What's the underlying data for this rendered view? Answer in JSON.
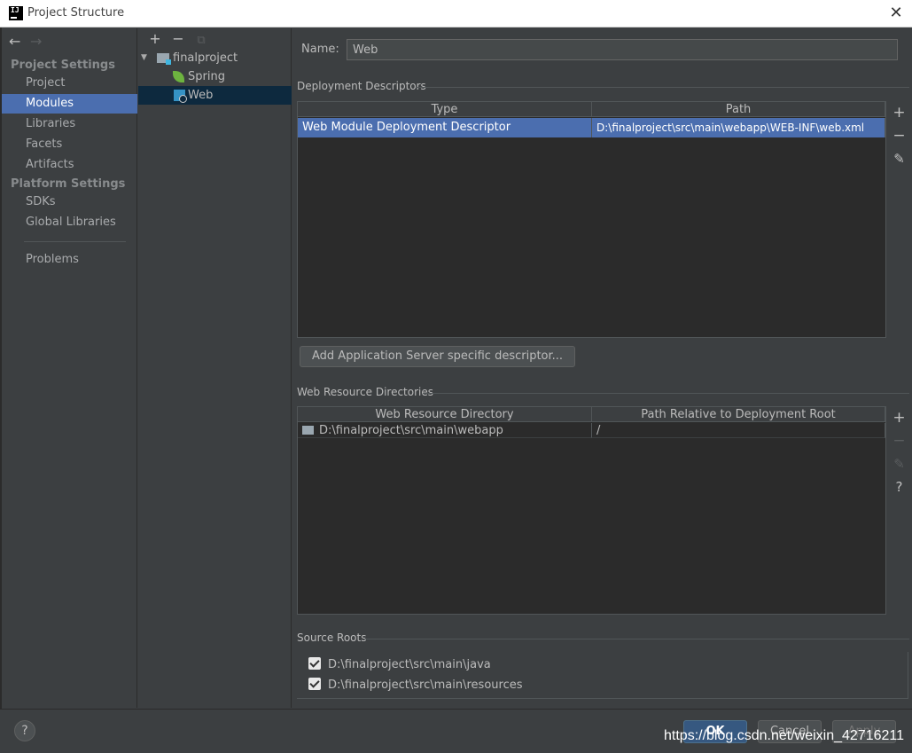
{
  "window": {
    "title": "Project Structure",
    "close_glyph": "✕",
    "logo_text": "IJ"
  },
  "left_nav": {
    "back_glyph": "←",
    "forward_glyph": "→",
    "project_settings_title": "Project Settings",
    "project_settings_items": [
      {
        "label": "Project",
        "selected": false
      },
      {
        "label": "Modules",
        "selected": true
      },
      {
        "label": "Libraries",
        "selected": false
      },
      {
        "label": "Facets",
        "selected": false
      },
      {
        "label": "Artifacts",
        "selected": false
      }
    ],
    "platform_settings_title": "Platform Settings",
    "platform_settings_items": [
      {
        "label": "SDKs"
      },
      {
        "label": "Global Libraries"
      }
    ],
    "problems_label": "Problems"
  },
  "module_tree": {
    "toolbar": {
      "add": "+",
      "remove": "−",
      "copy": "⧉"
    },
    "root": {
      "label": "finalproject",
      "expanded": true
    },
    "children": [
      {
        "label": "Spring",
        "icon": "spring-icon",
        "selected": false
      },
      {
        "label": "Web",
        "icon": "web-facet-icon",
        "selected": true
      }
    ]
  },
  "facet": {
    "name_label": "Name:",
    "name_value": "Web",
    "deployment_descriptors": {
      "title": "Deployment Descriptors",
      "columns": [
        "Type",
        "Path"
      ],
      "rows": [
        {
          "type": "Web Module Deployment Descriptor",
          "path": "D:\\finalproject\\src\\main\\webapp\\WEB-INF\\web.xml"
        }
      ],
      "add_server_descriptor_button": "Add Application Server specific descriptor..."
    },
    "web_resource_directories": {
      "title": "Web Resource Directories",
      "columns": [
        "Web Resource Directory",
        "Path Relative to Deployment Root"
      ],
      "rows": [
        {
          "directory": "D:\\finalproject\\src\\main\\webapp",
          "relative_path": "/"
        }
      ]
    },
    "source_roots": {
      "title": "Source Roots",
      "items": [
        {
          "path": "D:\\finalproject\\src\\main\\java",
          "checked": true
        },
        {
          "path": "D:\\finalproject\\src\\main\\resources",
          "checked": true
        }
      ]
    },
    "tool_glyphs": {
      "add": "+",
      "remove": "−",
      "edit": "✎",
      "help": "?"
    }
  },
  "footer": {
    "help_glyph": "?",
    "ok_label": "OK",
    "cancel_label": "Cancel",
    "apply_label": "Apply",
    "watermark": "https://blog.csdn.net/weixin_42716211"
  },
  "colors": {
    "background": "#3c3f41",
    "selection": "#4b6eaf",
    "tree_selection": "#0d293e",
    "table_background": "#2b2b2b",
    "ok_button": "#365880"
  }
}
